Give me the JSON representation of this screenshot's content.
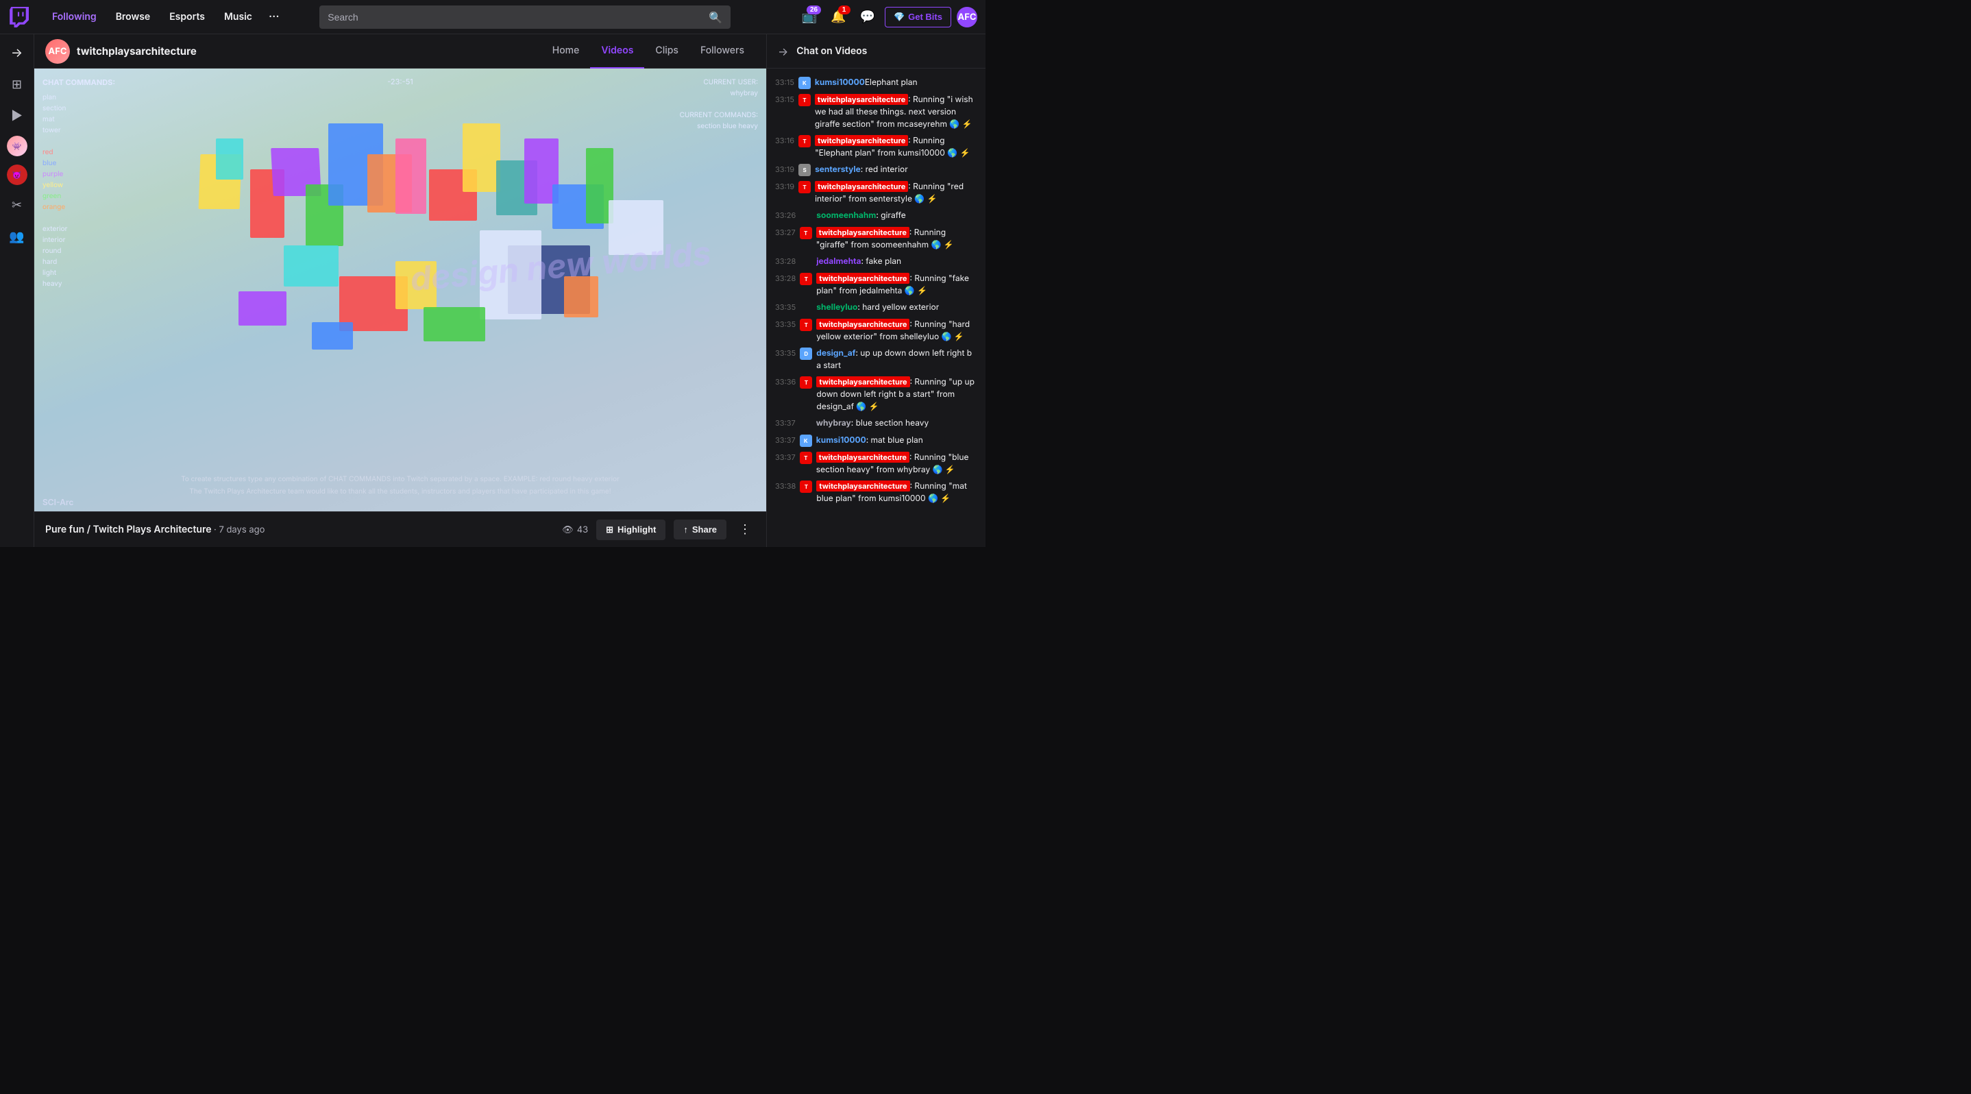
{
  "topnav": {
    "logo_label": "Twitch",
    "following_label": "Following",
    "browse_label": "Browse",
    "esports_label": "Esports",
    "music_label": "Music",
    "more_label": "···",
    "search_placeholder": "Search",
    "notifications_count": "26",
    "alerts_count": "1",
    "get_bits_label": "Get Bits",
    "avatar_initials": "AFC"
  },
  "sidebar": {
    "collapse_label": "→",
    "icons": [
      "⊞",
      "▶",
      "👾",
      "😈",
      "✂",
      "👥"
    ]
  },
  "channel": {
    "avatar_initials": "AFC",
    "channel_name": "twitchplaysarchitecture",
    "tabs": [
      {
        "label": "Home",
        "active": false
      },
      {
        "label": "Videos",
        "active": true
      },
      {
        "label": "Clips",
        "active": false
      },
      {
        "label": "Followers",
        "active": false
      }
    ]
  },
  "video": {
    "coords": "-23:-51",
    "current_user_label": "CURRENT USER:",
    "current_user": "whybray",
    "current_commands_label": "CURRENT COMMANDS:",
    "current_commands": "section blue heavy",
    "chat_commands_title": "CHAT COMMANDS:",
    "chat_commands": [
      "plan",
      "section",
      "mat",
      "tower",
      "",
      "red",
      "blue",
      "purple",
      "yellow",
      "green",
      "orange",
      "",
      "exterior",
      "interior",
      "round",
      "hard",
      "light",
      "heavy"
    ],
    "tagline": "design new worlds",
    "footer_text": "To create structures type any combination of CHAT COMMANDS into Twitch separated by a space.  EXAMPLE: red round heavy exterior",
    "footer_thanks": "The Twitch Plays Architecture team would like to thank all the students, instructors and players that have participated in this game!",
    "sci_arc_label": "SCI-Arc",
    "title": "Pure fun / Twitch Plays Architecture",
    "age": "7 days ago",
    "views": "43",
    "highlight_label": "Highlight",
    "share_label": "Share",
    "more_label": "⋮"
  },
  "chat": {
    "title": "Chat on Videos",
    "messages": [
      {
        "time": "33:15",
        "user": "kumsi10000",
        "user_type": "normal",
        "text": "Elephant plan",
        "has_av": true,
        "av_color": "#5ba4fc"
      },
      {
        "time": "33:15",
        "user": "twitchplaysarchitecture",
        "user_type": "streamer",
        "text": ": Running \"i wish we had all these things. next version giraffe section\" from mcaseyrehm 🌎 ⚡",
        "has_av": true,
        "av_color": "#eb0400"
      },
      {
        "time": "33:16",
        "user": "twitchplaysarchitecture",
        "user_type": "streamer",
        "text": ": Running \"Elephant plan\" from kumsi10000 🌎 ⚡",
        "has_av": true,
        "av_color": "#eb0400"
      },
      {
        "time": "33:19",
        "user": "senterstyle",
        "user_type": "blue",
        "text": ": red interior",
        "has_av": true,
        "av_color": "#888"
      },
      {
        "time": "33:19",
        "user": "twitchplaysarchitecture",
        "user_type": "streamer",
        "text": ": Running \"red interior\" from senterstyle 🌎 ⚡",
        "has_av": true,
        "av_color": "#eb0400"
      },
      {
        "time": "33:26",
        "user": "soomeenhahm",
        "user_type": "green",
        "text": ": giraffe",
        "has_av": false,
        "av_color": ""
      },
      {
        "time": "33:27",
        "user": "twitchplaysarchitecture",
        "user_type": "streamer",
        "text": ": Running \"giraffe\" from soomeenhahm 🌎 ⚡",
        "has_av": true,
        "av_color": "#eb0400"
      },
      {
        "time": "33:28",
        "user": "jedalmehta",
        "user_type": "purple",
        "text": ": fake plan",
        "has_av": false,
        "av_color": ""
      },
      {
        "time": "33:28",
        "user": "twitchplaysarchitecture",
        "user_type": "streamer",
        "text": ": Running \"fake plan\" from jedalmehta 🌎 ⚡",
        "has_av": true,
        "av_color": "#eb0400"
      },
      {
        "time": "33:35",
        "user": "shelleyluo",
        "user_type": "green",
        "text": ": hard yellow exterior",
        "has_av": false,
        "av_color": ""
      },
      {
        "time": "33:35",
        "user": "twitchplaysarchitecture",
        "user_type": "streamer",
        "text": ": Running \"hard yellow exterior\" from shelleyluo 🌎 ⚡",
        "has_av": true,
        "av_color": "#eb0400"
      },
      {
        "time": "33:35",
        "user": "design_af",
        "user_type": "blue",
        "text": ": up up down down left right b a start",
        "has_av": true,
        "av_color": "#5ba4fc"
      },
      {
        "time": "33:36",
        "user": "twitchplaysarchitecture",
        "user_type": "streamer",
        "text": ": Running \"up up down down left right b a start\" from design_af 🌎 ⚡",
        "has_av": true,
        "av_color": "#eb0400"
      },
      {
        "time": "33:37",
        "user": "whybray",
        "user_type": "gray",
        "text": ": blue section heavy",
        "has_av": false,
        "av_color": ""
      },
      {
        "time": "33:37",
        "user": "kumsi10000",
        "user_type": "normal",
        "text": ": mat blue plan",
        "has_av": true,
        "av_color": "#5ba4fc"
      },
      {
        "time": "33:37",
        "user": "twitchplaysarchitecture",
        "user_type": "streamer",
        "text": ": Running \"blue section heavy\" from whybray 🌎 ⚡",
        "has_av": true,
        "av_color": "#eb0400"
      },
      {
        "time": "33:38",
        "user": "twitchplaysarchitecture",
        "user_type": "streamer",
        "text": ": Running \"mat blue plan\" from kumsi10000 🌎 ⚡",
        "has_av": true,
        "av_color": "#eb0400"
      }
    ]
  }
}
